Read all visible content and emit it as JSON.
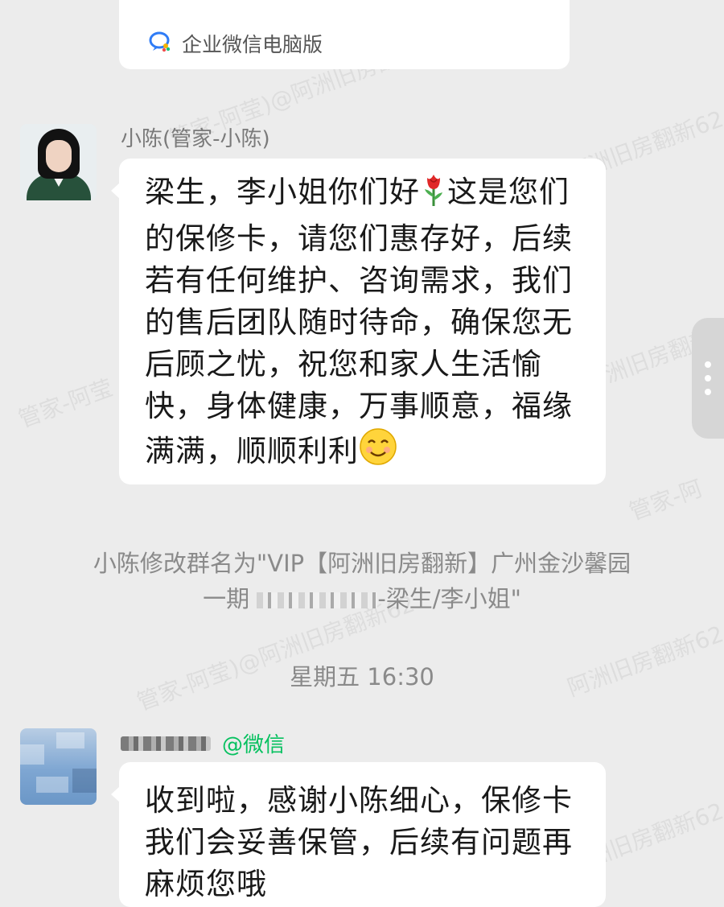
{
  "top_card": {
    "source_label": "企业微信电脑版",
    "icon": "wecom-icon"
  },
  "messages": [
    {
      "sender": "小陈(管家-小陈)",
      "avatar": "avatar-woman",
      "text_parts": [
        "梁生，李小姐你们好",
        "这是您们的保修卡，请您们惠存好，后续若有任何维护、咨询需求，我们的售后团队随时待命，确保您无后顾之忧，祝您和家人生活愉快，身体健康，万事顺意，福缘满满，顺顺利利"
      ],
      "emojis": [
        "rose-emoji",
        "smile-emoji"
      ]
    },
    {
      "sender_suffix": "@微信",
      "avatar": "avatar-blurred",
      "text": "收到啦，感谢小陈细心，保修卡我们会妥善保管，后续有问题再麻烦您哦"
    }
  ],
  "system": {
    "rename_prefix": "小陈修改群名为\"VIP【阿洲旧房翻新】广州金沙馨园",
    "rename_line2_start": "一期",
    "rename_line2_end": "-梁生/李小姐\""
  },
  "time_label": "星期五  16:30",
  "watermarks": [
    "管家-阿莹",
    "阿洲旧房翻新62",
    "管家-阿莹)@阿洲旧房翻新62",
    "管家-阿"
  ],
  "colors": {
    "background": "#ececec",
    "wechat_green": "#07c160"
  }
}
